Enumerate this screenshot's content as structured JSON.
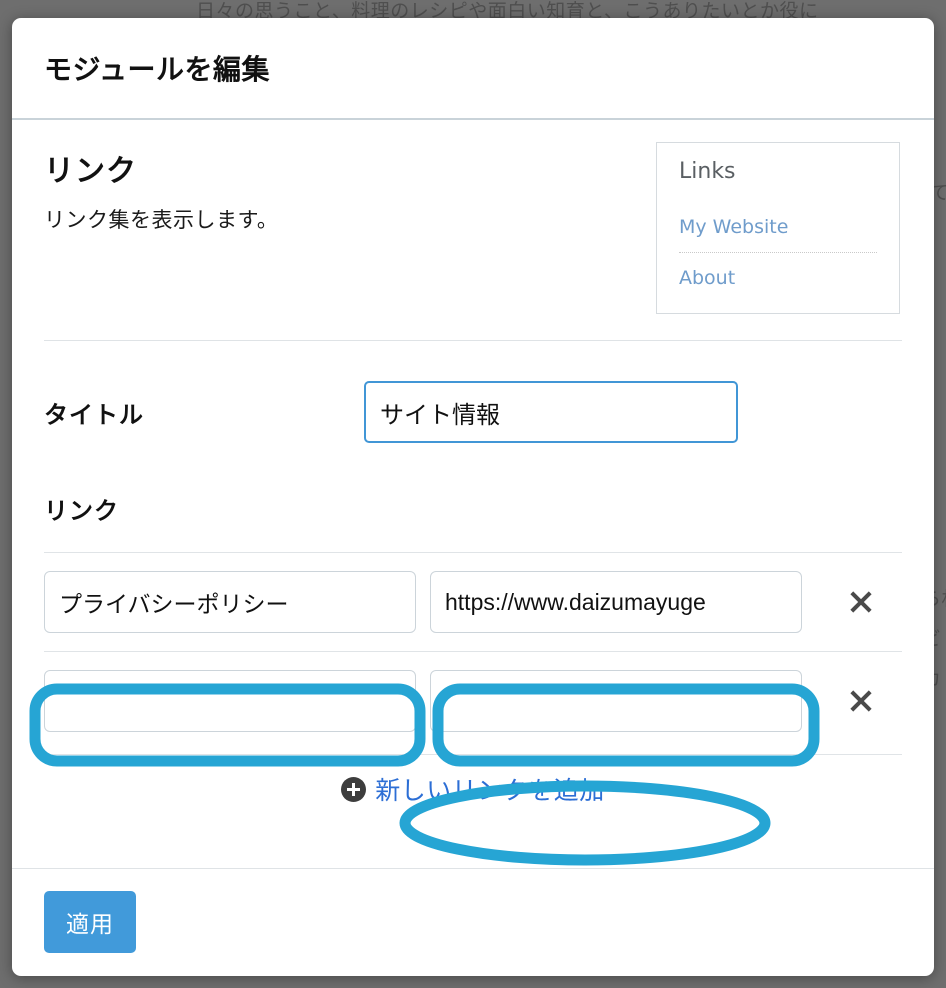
{
  "background": {
    "lines": [
      "日々の思うこと、料理のレシピや面白い知育と、こうありたいとか役に",
      "て",
      "ら材",
      "ビ",
      "カ"
    ]
  },
  "modal": {
    "title": "モジュールを編集",
    "module": {
      "name": "リンク",
      "description": "リンク集を表示します。"
    },
    "preview": {
      "heading": "Links",
      "links": [
        "My Website",
        "About"
      ]
    },
    "title_field": {
      "label": "タイトル",
      "value": "サイト情報",
      "placeholder": ""
    },
    "links_section": {
      "label": "リンク",
      "rows": [
        {
          "name": "プライバシーポリシー",
          "url": "https://www.daizumayuge",
          "name_placeholder": "",
          "url_placeholder": "",
          "remove_label": "×"
        },
        {
          "name": "",
          "url": "",
          "name_placeholder": "",
          "url_placeholder": "",
          "remove_label": "×"
        }
      ],
      "add_label": "新しいリンクを追加"
    },
    "footer": {
      "apply_label": "適用"
    }
  },
  "colors": {
    "annotation_blue": "#26a5d4",
    "accent_blue": "#419ada",
    "link_blue": "#2c6ed5",
    "backdrop": "#6e6e6e"
  }
}
